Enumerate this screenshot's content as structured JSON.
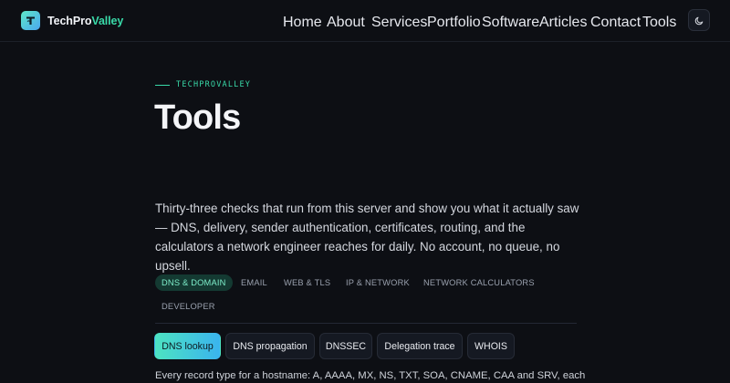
{
  "brand": {
    "part1": "TechPro",
    "part2": "Valley",
    "logo_icon": "t-logo-icon"
  },
  "nav": {
    "items": [
      {
        "label": "Home"
      },
      {
        "label": "About"
      },
      {
        "label": "Services"
      },
      {
        "label": "Portfolio"
      },
      {
        "label": "Software"
      },
      {
        "label": "Articles"
      },
      {
        "label": "Contact"
      },
      {
        "label": "Tools",
        "active": true
      }
    ],
    "theme_toggle_icon": "moon-icon"
  },
  "page": {
    "eyebrow": "TECHPROVALLEY",
    "title": "Tools",
    "lede": "Thirty-three checks that run from this server and show you what it actually saw — DNS, delivery, sender authentication, certificates, routing, and the calculators a network engineer reaches for daily. No account, no queue, no upsell."
  },
  "categories": [
    {
      "label": "DNS & DOMAIN",
      "active": true
    },
    {
      "label": "EMAIL"
    },
    {
      "label": "WEB & TLS"
    },
    {
      "label": "IP & NETWORK"
    },
    {
      "label": "NETWORK CALCULATORS"
    },
    {
      "label": "DEVELOPER"
    }
  ],
  "tools": [
    {
      "label": "DNS lookup",
      "active": true
    },
    {
      "label": "DNS propagation"
    },
    {
      "label": "DNSSEC"
    },
    {
      "label": "Delegation trace"
    },
    {
      "label": "WHOIS"
    }
  ],
  "tool_description": "Every record type for a hostname: A, AAAA, MX, NS, TXT, SOA, CNAME, CAA and SRV, each",
  "colors": {
    "accent": "#39d9a8",
    "background": "#0d0f14"
  }
}
